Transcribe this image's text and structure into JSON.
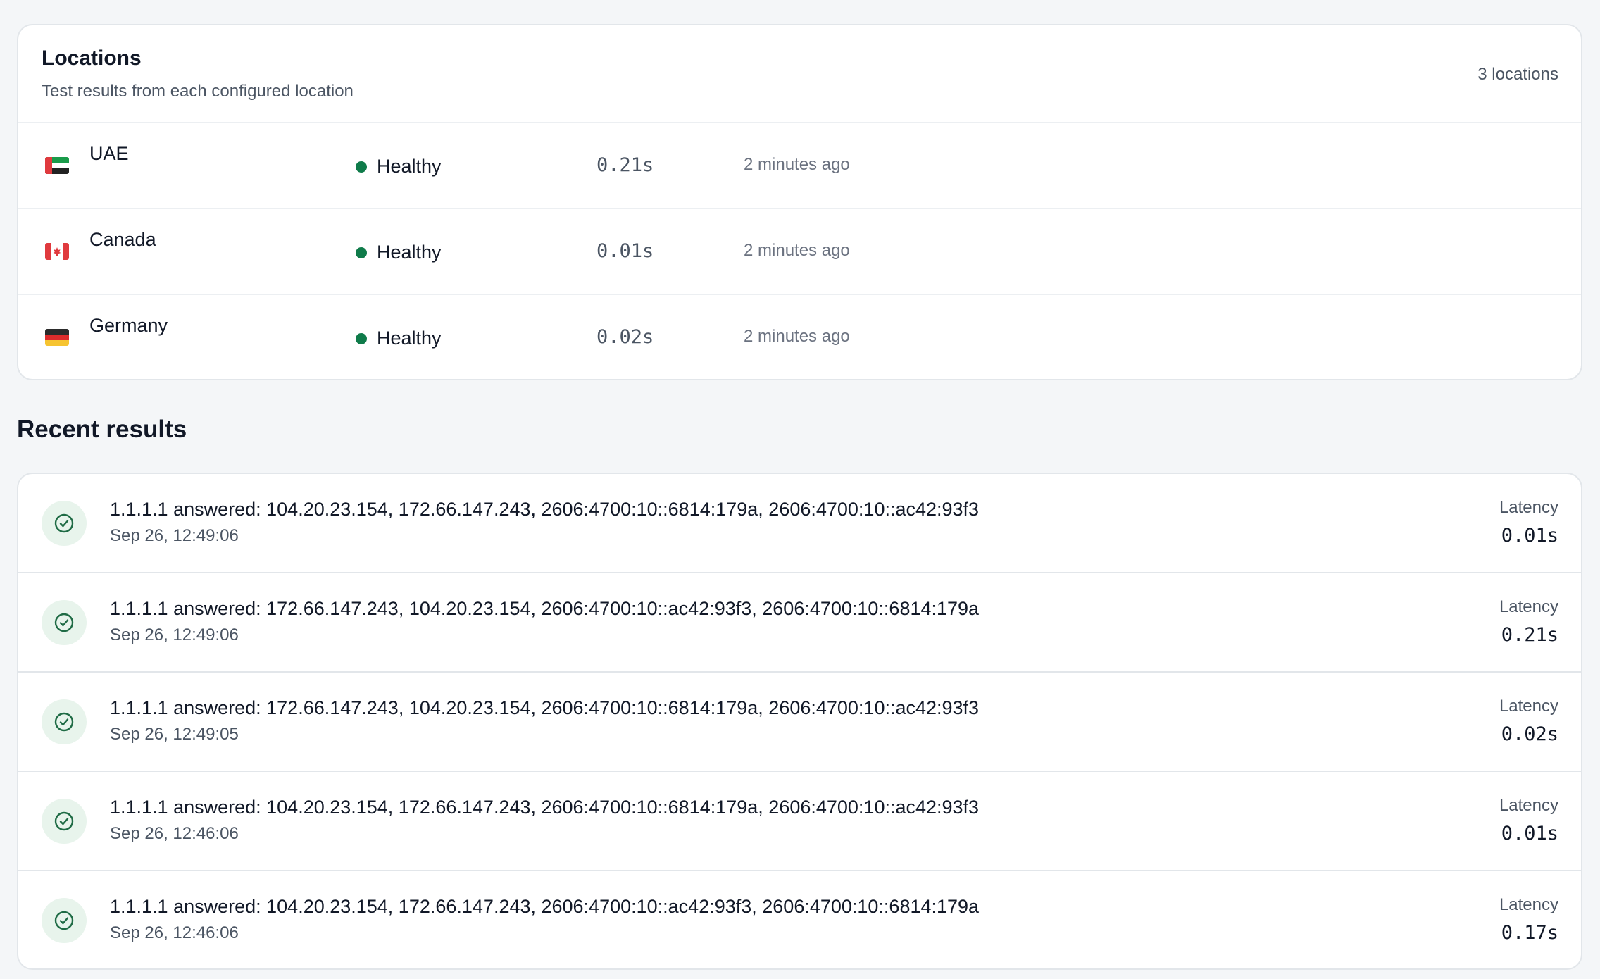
{
  "locations": {
    "title": "Locations",
    "subtitle": "Test results from each configured location",
    "count_label": "3 locations",
    "items": [
      {
        "name": "UAE",
        "flag": "uae-flag-icon",
        "status": "Healthy",
        "latency": "0.21s",
        "last_checked": "2 minutes ago"
      },
      {
        "name": "Canada",
        "flag": "canada-flag-icon",
        "status": "Healthy",
        "latency": "0.01s",
        "last_checked": "2 minutes ago"
      },
      {
        "name": "Germany",
        "flag": "germany-flag-icon",
        "status": "Healthy",
        "latency": "0.02s",
        "last_checked": "2 minutes ago"
      }
    ]
  },
  "recent_results": {
    "title": "Recent results",
    "latency_label": "Latency",
    "items": [
      {
        "text": "1.1.1.1 answered: 104.20.23.154, 172.66.147.243, 2606:4700:10::6814:179a, 2606:4700:10::ac42:93f3",
        "timestamp": "Sep 26, 12:49:06",
        "latency": "0.01s",
        "icon": "check-circle-icon"
      },
      {
        "text": "1.1.1.1 answered: 172.66.147.243, 104.20.23.154, 2606:4700:10::ac42:93f3, 2606:4700:10::6814:179a",
        "timestamp": "Sep 26, 12:49:06",
        "latency": "0.21s",
        "icon": "check-circle-icon"
      },
      {
        "text": "1.1.1.1 answered: 172.66.147.243, 104.20.23.154, 2606:4700:10::6814:179a, 2606:4700:10::ac42:93f3",
        "timestamp": "Sep 26, 12:49:05",
        "latency": "0.02s",
        "icon": "check-circle-icon"
      },
      {
        "text": "1.1.1.1 answered: 104.20.23.154, 172.66.147.243, 2606:4700:10::6814:179a, 2606:4700:10::ac42:93f3",
        "timestamp": "Sep 26, 12:46:06",
        "latency": "0.01s",
        "icon": "check-circle-icon"
      },
      {
        "text": "1.1.1.1 answered: 104.20.23.154, 172.66.147.243, 2606:4700:10::ac42:93f3, 2606:4700:10::6814:179a",
        "timestamp": "Sep 26, 12:46:06",
        "latency": "0.17s",
        "icon": "check-circle-icon"
      }
    ]
  },
  "colors": {
    "healthy": "#0f7b4a",
    "check_icon": "#1f6b45",
    "check_bg": "#e8f4ec",
    "background": "#f4f6f8"
  }
}
